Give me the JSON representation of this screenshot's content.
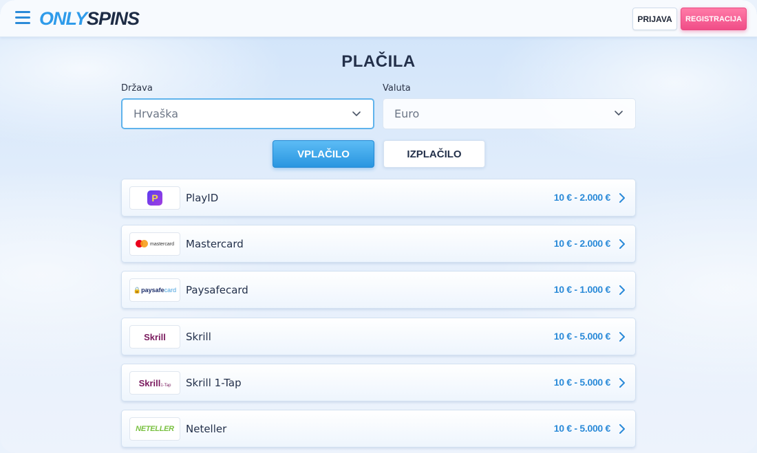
{
  "header": {
    "logo_only": "ONLY",
    "logo_spins": "SPINS",
    "login_label": "PRIJAVA",
    "register_label": "REGISTRACIJA",
    "menu_icon": "hamburger-menu-icon"
  },
  "page": {
    "title": "PLAČILA"
  },
  "filters": {
    "country_label": "Država",
    "country_value": "Hrvaška",
    "currency_label": "Valuta",
    "currency_value": "Euro"
  },
  "tabs": [
    {
      "label": "VPLAČILO",
      "active": true
    },
    {
      "label": "IZPLAČILO",
      "active": false
    }
  ],
  "methods": [
    {
      "name": "PlayID",
      "range": "10 € - 2.000 €",
      "logo_text": "P"
    },
    {
      "name": "Mastercard",
      "range": "10 € - 2.000 €",
      "logo_text": "mastercard"
    },
    {
      "name": "Paysafecard",
      "range": "10 € - 1.000 €",
      "logo_text_a": "paysafe",
      "logo_text_b": "card"
    },
    {
      "name": "Skrill",
      "range": "10 € - 5.000 €",
      "logo_text": "Skrill"
    },
    {
      "name": "Skrill 1-Tap",
      "range": "10 € - 5.000 €",
      "logo_text": "Skrill",
      "logo_sub": "1-Tap"
    },
    {
      "name": "Neteller",
      "range": "10 € - 5.000 €",
      "logo_text": "NETELLER"
    }
  ],
  "colors": {
    "accent": "#2a8ad8",
    "register": "#f04d87",
    "title": "#23304a"
  }
}
